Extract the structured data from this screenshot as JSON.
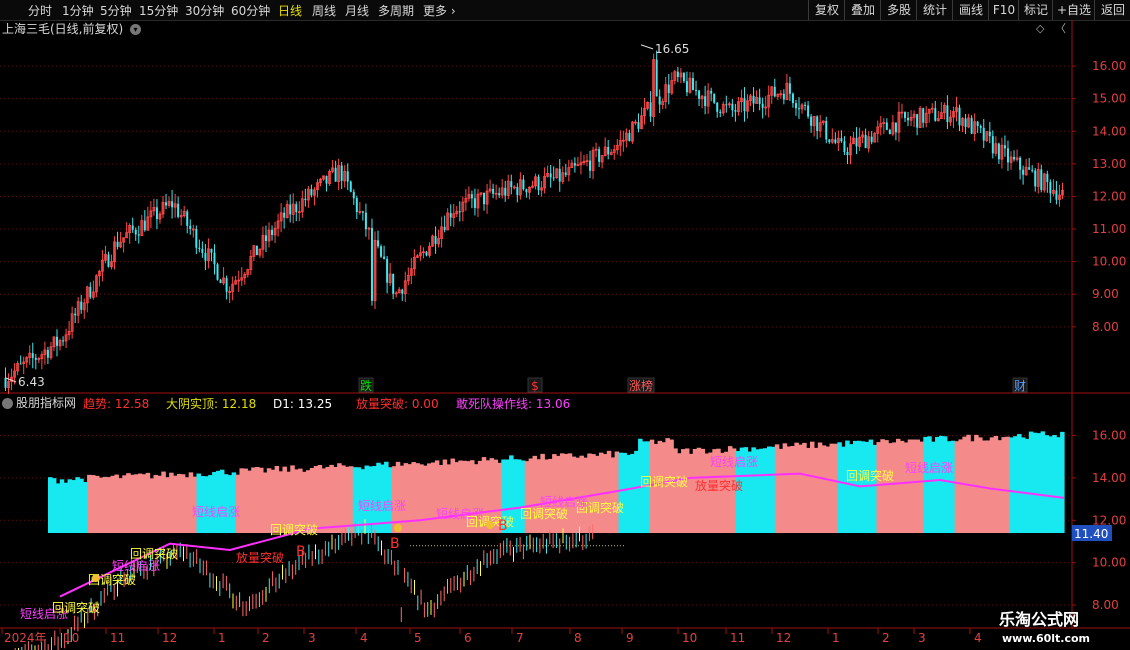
{
  "toolbar": {
    "periods": [
      {
        "label": "分时",
        "active": false
      },
      {
        "label": "1分钟",
        "active": false
      },
      {
        "label": "5分钟",
        "active": false
      },
      {
        "label": "15分钟",
        "active": false
      },
      {
        "label": "30分钟",
        "active": false
      },
      {
        "label": "60分钟",
        "active": false
      },
      {
        "label": "日线",
        "active": true
      },
      {
        "label": "周线",
        "active": false
      },
      {
        "label": "月线",
        "active": false
      },
      {
        "label": "多周期",
        "active": false
      },
      {
        "label": "更多",
        "active": false
      }
    ],
    "right_buttons": [
      "复权",
      "叠加",
      "多股",
      "统计",
      "画线",
      "F10",
      "标记",
      "+自选",
      "返回"
    ]
  },
  "main_chart": {
    "title": "上海三毛(日线,前复权)",
    "high_label": "16.65",
    "low_label": "6.43",
    "y_ticks": [
      "16.00",
      "15.00",
      "14.00",
      "13.00",
      "12.00",
      "11.00",
      "10.00",
      "9.00",
      "8.00"
    ],
    "markers": [
      {
        "text": "跌",
        "color": "#00e000"
      },
      {
        "text": "$",
        "color": "#ff3030"
      },
      {
        "text": "涨榜",
        "color": "#ff5a5a"
      },
      {
        "text": "财",
        "color": "#5aa0ff"
      }
    ]
  },
  "indicator": {
    "name": "股朋指标网",
    "values": [
      {
        "label": "趋势:",
        "value": "12.58",
        "color": "#ff3030"
      },
      {
        "label": "大阴实顶:",
        "value": "12.18",
        "color": "#e0e000"
      },
      {
        "label": "D1:",
        "value": "13.25",
        "color": "#ffffff"
      },
      {
        "label": "放量突破:",
        "value": "0.00",
        "color": "#ff3030"
      },
      {
        "label": "敢死队操作线:",
        "value": "13.06",
        "color": "#ff40ff"
      }
    ],
    "y_ticks": [
      "16.00",
      "14.00",
      "12.00",
      "10.00",
      "8.00"
    ],
    "current_value": "11.40",
    "signals": [
      {
        "text": "短线启涨",
        "color": "#ff40ff"
      },
      {
        "text": "回调突破",
        "color": "#ffff40"
      },
      {
        "text": "短线启涨",
        "color": "#ff40ff"
      },
      {
        "text": "回调突破",
        "color": "#ffff40"
      },
      {
        "text": "回调突破",
        "color": "#ffff40"
      },
      {
        "text": "短线启涨",
        "color": "#ff40ff"
      },
      {
        "text": "放量突破",
        "color": "#ff3030"
      },
      {
        "text": "B",
        "color": "#ff3030"
      },
      {
        "text": "回调突破",
        "color": "#ffff40"
      },
      {
        "text": "短线启涨",
        "color": "#ff40ff"
      },
      {
        "text": "B",
        "color": "#ff3030"
      },
      {
        "text": "短线启涨",
        "color": "#ff40ff"
      },
      {
        "text": "回调突破",
        "color": "#ffff40"
      },
      {
        "text": "回调突破",
        "color": "#ffff40"
      },
      {
        "text": "回调突破",
        "color": "#ffff40"
      },
      {
        "text": "短线启涨",
        "color": "#ff40ff"
      },
      {
        "text": "放量突破",
        "color": "#ff3030"
      },
      {
        "text": "短线启涨",
        "color": "#ff40ff"
      },
      {
        "text": "回调突破",
        "color": "#ffff40"
      },
      {
        "text": "回调突破",
        "color": "#ffff40"
      },
      {
        "text": "短线启涨",
        "color": "#ff40ff"
      },
      {
        "text": "B",
        "color": "#ff3030"
      }
    ]
  },
  "x_axis": {
    "labels": [
      "2024年",
      "10",
      "11",
      "12",
      "1",
      "2",
      "3",
      "4",
      "5",
      "6",
      "7",
      "8",
      "9",
      "10",
      "11",
      "12",
      "1",
      "2",
      "3",
      "4"
    ]
  },
  "watermark": {
    "name": "乐淘公式网",
    "url": "www.60lt.com"
  },
  "chart_data": {
    "type": "candlestick",
    "instrument": "上海三毛",
    "period": "日线",
    "adjust": "前复权",
    "ylim": [
      6.0,
      17.0
    ],
    "series": [
      {
        "name": "close",
        "points": [
          [
            "2024年",
            6.43
          ],
          [
            "10",
            7.6
          ],
          [
            "11",
            10.6
          ],
          [
            "12",
            11.8
          ],
          [
            "1",
            9.2
          ],
          [
            "2",
            11.4
          ],
          [
            "3",
            12.8
          ],
          [
            "4",
            9.0
          ],
          [
            "5",
            11.6
          ],
          [
            "6",
            12.2
          ],
          [
            "7",
            12.6
          ],
          [
            "8",
            13.6
          ],
          [
            "9",
            15.6
          ],
          [
            "10",
            14.6
          ],
          [
            "11",
            15.3
          ],
          [
            "12",
            13.4
          ],
          [
            "1",
            14.3
          ],
          [
            "2",
            14.6
          ],
          [
            "3",
            13.1
          ],
          [
            "4",
            12.0
          ]
        ]
      },
      {
        "name": "敢死队操作线",
        "points": [
          [
            "10",
            8.4
          ],
          [
            "12",
            10.9
          ],
          [
            "2",
            10.6
          ],
          [
            "3",
            11.6
          ],
          [
            "5",
            12.0
          ],
          [
            "7",
            12.6
          ],
          [
            "9",
            13.4
          ],
          [
            "10",
            14.0
          ],
          [
            "12",
            14.2
          ],
          [
            "1",
            13.6
          ],
          [
            "2",
            13.9
          ],
          [
            "3",
            13.5
          ],
          [
            "4",
            13.06
          ]
        ]
      }
    ],
    "high": 16.65,
    "low": 6.43
  }
}
